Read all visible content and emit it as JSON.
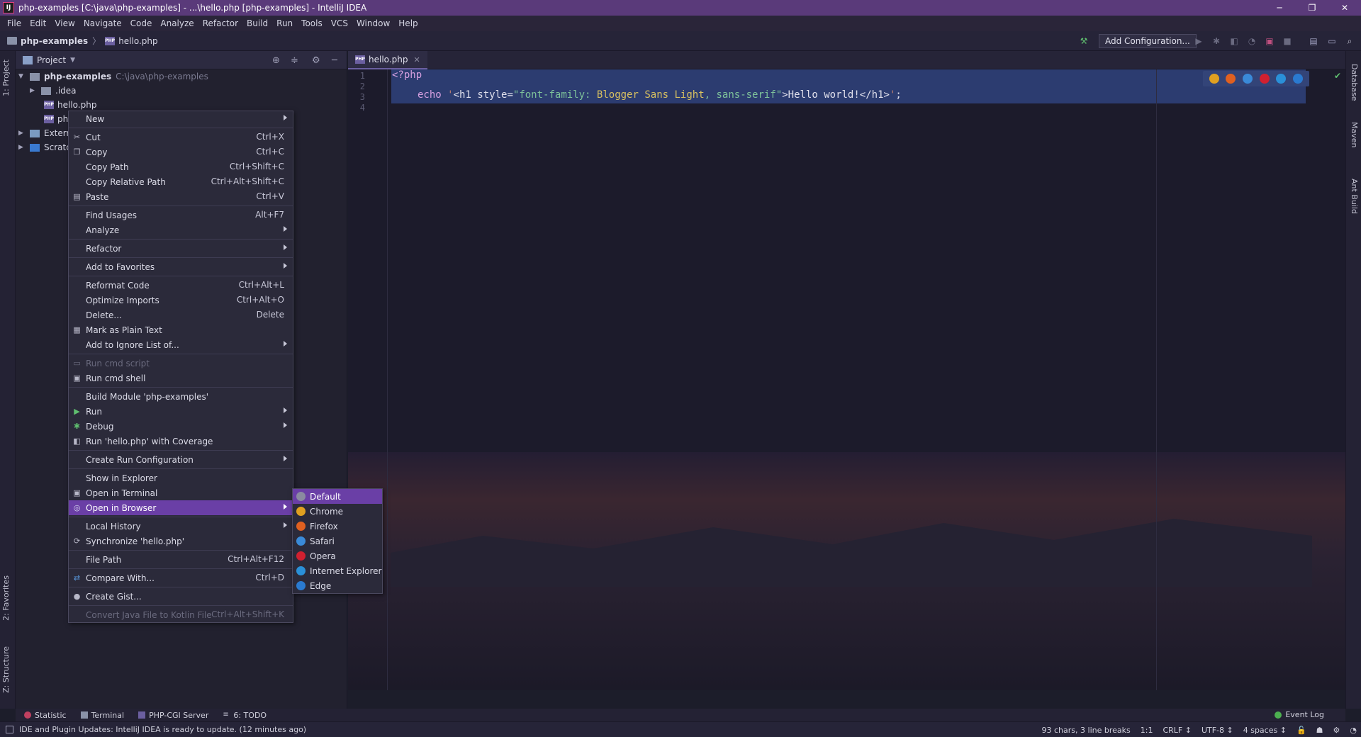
{
  "window": {
    "title": "php-examples [C:\\java\\php-examples] - ...\\hello.php [php-examples] - IntelliJ IDEA",
    "app_icon": "IJ",
    "controls": [
      "─",
      "❐",
      "✕"
    ]
  },
  "menubar": [
    "File",
    "Edit",
    "View",
    "Navigate",
    "Code",
    "Analyze",
    "Refactor",
    "Build",
    "Run",
    "Tools",
    "VCS",
    "Window",
    "Help"
  ],
  "navbar": {
    "project": "php-examples",
    "file": "hello.php",
    "add_configuration": "Add Configuration..."
  },
  "left_stripe": {
    "project_tab": "1: Project",
    "favorites_tab": "2: Favorites",
    "structure_tab": "Z: Structure"
  },
  "right_stripe": {
    "database_tab": "Database",
    "maven_tab": "Maven",
    "ant_tab": "Ant Build"
  },
  "project_panel": {
    "header": "Project",
    "tree": [
      {
        "label": "php-examples",
        "path": "C:\\java\\php-examples"
      },
      {
        "label": ".idea"
      },
      {
        "label": "hello.php"
      },
      {
        "label": "php"
      },
      {
        "label": "Externa"
      },
      {
        "label": "Scratcl"
      }
    ]
  },
  "editor": {
    "tab": "hello.php",
    "line_numbers": [
      "1",
      "2",
      "3",
      "4"
    ],
    "code": {
      "line1": "<?php",
      "echo": "echo ",
      "q1": "'",
      "h1_open": "<h1 ",
      "style_attr": "style=",
      "val_open": "\"font-family: ",
      "font": "Blogger Sans Light",
      "comma": ", ",
      "sans": "sans-serif",
      "val_close": "\"",
      "after": ">Hello world!</h1>",
      "q2": "'",
      "semi": ";"
    }
  },
  "context_menu": {
    "items": [
      {
        "label": "New",
        "shortcut": "",
        "submenu": true
      },
      {
        "label": "Cut",
        "shortcut": "Ctrl+X",
        "icon": "scissors-icon"
      },
      {
        "label": "Copy",
        "shortcut": "Ctrl+C",
        "icon": "copy-icon"
      },
      {
        "label": "Copy Path",
        "shortcut": "Ctrl+Shift+C"
      },
      {
        "label": "Copy Relative Path",
        "shortcut": "Ctrl+Alt+Shift+C"
      },
      {
        "label": "Paste",
        "shortcut": "Ctrl+V",
        "icon": "clipboard-icon"
      },
      {
        "label": "Find Usages",
        "shortcut": "Alt+F7"
      },
      {
        "label": "Analyze",
        "submenu": true
      },
      {
        "label": "Refactor",
        "submenu": true
      },
      {
        "label": "Add to Favorites",
        "submenu": true
      },
      {
        "label": "Reformat Code",
        "shortcut": "Ctrl+Alt+L"
      },
      {
        "label": "Optimize Imports",
        "shortcut": "Ctrl+Alt+O"
      },
      {
        "label": "Delete...",
        "shortcut": "Delete"
      },
      {
        "label": "Mark as Plain Text",
        "icon": "text-file-icon"
      },
      {
        "label": "Add to Ignore List of...",
        "submenu": true
      },
      {
        "label": "Run cmd script",
        "disabled": true
      },
      {
        "label": "Run cmd shell",
        "icon": "terminal-icon"
      },
      {
        "label": "Build Module 'php-examples'"
      },
      {
        "label": "Run",
        "submenu": true,
        "icon": "play-icon"
      },
      {
        "label": "Debug",
        "submenu": true,
        "icon": "bug-icon"
      },
      {
        "label": "Run 'hello.php' with Coverage",
        "icon": "coverage-icon"
      },
      {
        "label": "Create Run Configuration",
        "submenu": true
      },
      {
        "label": "Show in Explorer"
      },
      {
        "label": "Open in Terminal",
        "icon": "terminal-icon"
      },
      {
        "label": "Open in Browser",
        "submenu": true,
        "highlighted": true,
        "icon": "globe-icon"
      },
      {
        "label": "Local History",
        "submenu": true
      },
      {
        "label": "Synchronize 'hello.php'",
        "icon": "sync-icon"
      },
      {
        "label": "File Path",
        "shortcut": "Ctrl+Alt+F12"
      },
      {
        "label": "Compare With...",
        "shortcut": "Ctrl+D",
        "icon": "compare-icon"
      },
      {
        "label": "Create Gist...",
        "icon": "github-icon"
      },
      {
        "label": "Convert Java File to Kotlin File",
        "shortcut": "Ctrl+Alt+Shift+K",
        "disabled": true
      }
    ]
  },
  "browser_submenu": [
    {
      "label": "Default",
      "color": "#8a8aa0"
    },
    {
      "label": "Chrome",
      "color": "#e0a020"
    },
    {
      "label": "Firefox",
      "color": "#e06020"
    },
    {
      "label": "Safari",
      "color": "#3a8ad8"
    },
    {
      "label": "Opera",
      "color": "#d02030"
    },
    {
      "label": "Internet Explorer",
      "color": "#2a90d8"
    },
    {
      "label": "Edge",
      "color": "#2a7ad0"
    }
  ],
  "bottom_tabs": [
    "Statistic",
    "Terminal",
    "PHP-CGI Server",
    "6: TODO"
  ],
  "event_log": "Event Log",
  "status": {
    "message": "IDE and Plugin Updates: IntelliJ IDEA is ready to update. (12 minutes ago)",
    "chars": "93 chars, 3 line breaks",
    "position": "1:1",
    "line_sep": "CRLF ↕",
    "encoding": "UTF-8 ↕",
    "indent": "4 spaces ↕"
  },
  "colors": {
    "accent": "#6a3fa6",
    "titlebar": "#5a3a7a",
    "selection": "#2c3c70"
  }
}
